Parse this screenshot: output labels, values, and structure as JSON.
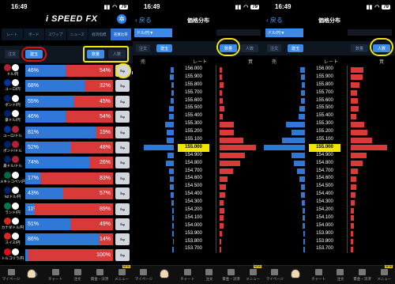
{
  "status": {
    "time": "16:49",
    "battery": "79"
  },
  "main": {
    "logo": "i SPEED FX",
    "tabs": [
      "レート",
      "ボード",
      "スワップ",
      "ニュース",
      "経済指標",
      "売買比率"
    ],
    "sub_tabs": [
      "注文",
      "建玉"
    ],
    "mode_buttons": [
      "数量",
      "人数"
    ],
    "pairs": [
      {
        "name": "ドル/円",
        "buy": "46%",
        "sell": "54%",
        "buy_frac": 0.46,
        "c1": "#b22234",
        "c2": "#ffffff"
      },
      {
        "name": "ユーロ/円",
        "buy": "68%",
        "sell": "32%",
        "buy_frac": 0.68,
        "c1": "#003399",
        "c2": "#ffffff"
      },
      {
        "name": "ポンド/円",
        "buy": "55%",
        "sell": "45%",
        "buy_frac": 0.55,
        "c1": "#012169",
        "c2": "#ffffff"
      },
      {
        "name": "豪ドル/円",
        "buy": "46%",
        "sell": "54%",
        "buy_frac": 0.46,
        "c1": "#012169",
        "c2": "#ffffff"
      },
      {
        "name": "ユーロ/ドル",
        "buy": "81%",
        "sell": "19%",
        "buy_frac": 0.81,
        "c1": "#003399",
        "c2": "#b22234"
      },
      {
        "name": "ポンド/ドル",
        "buy": "52%",
        "sell": "48%",
        "buy_frac": 0.52,
        "c1": "#012169",
        "c2": "#b22234"
      },
      {
        "name": "豪ドル/ドル",
        "buy": "74%",
        "sell": "26%",
        "buy_frac": 0.74,
        "c1": "#012169",
        "c2": "#b22234"
      },
      {
        "name": "メキシコペソ/円",
        "buy": "17%",
        "sell": "83%",
        "buy_frac": 0.17,
        "c1": "#006847",
        "c2": "#ffffff"
      },
      {
        "name": "NZドル/円",
        "buy": "43%",
        "sell": "57%",
        "buy_frac": 0.43,
        "c1": "#012169",
        "c2": "#ffffff"
      },
      {
        "name": "ランド/円",
        "buy": "11%",
        "sell": "89%",
        "buy_frac": 0.11,
        "c1": "#007a4d",
        "c2": "#ffffff"
      },
      {
        "name": "カナダドル/円",
        "buy": "51%",
        "sell": "49%",
        "buy_frac": 0.51,
        "c1": "#d52b1e",
        "c2": "#ffffff"
      },
      {
        "name": "スイス/円",
        "buy": "86%",
        "sell": "14%",
        "buy_frac": 0.86,
        "c1": "#d52b1e",
        "c2": "#ffffff"
      },
      {
        "name": "トルコリラ/円",
        "buy": "0%",
        "sell": "100%",
        "buy_frac": 0.0,
        "c1": "#e30a17",
        "c2": "#ffffff"
      }
    ]
  },
  "dist": {
    "back": "戻る",
    "title": "価格分布",
    "pair": "ドル/円▼",
    "mode_buttons": [
      "注文",
      "建玉",
      "数量",
      "人数"
    ],
    "col_sell": "売",
    "col_rate": "レート",
    "col_buy": "買",
    "current_price": "155.000",
    "prices": [
      "156.000",
      "155.900",
      "155.800",
      "155.700",
      "155.600",
      "155.500",
      "155.400",
      "155.300",
      "155.200",
      "155.100",
      "155.000",
      "154.900",
      "154.800",
      "154.700",
      "154.600",
      "154.500",
      "154.400",
      "154.300",
      "154.200",
      "154.100",
      "154.000",
      "153.900",
      "153.800",
      "153.700"
    ]
  },
  "dist_qty": {
    "sell": [
      4,
      5,
      3,
      3,
      4,
      6,
      6,
      11,
      9,
      9,
      38,
      8,
      10,
      6,
      5,
      5,
      4,
      3,
      2,
      2,
      2,
      2,
      1,
      2
    ],
    "buy": [
      3,
      3,
      5,
      3,
      4,
      6,
      4,
      17,
      17,
      29,
      44,
      31,
      25,
      16,
      10,
      8,
      7,
      5,
      6,
      5,
      5,
      3,
      2,
      2
    ]
  },
  "dist_ppl": {
    "sell": [
      6,
      5,
      4,
      5,
      5,
      7,
      8,
      24,
      17,
      29,
      52,
      17,
      14,
      10,
      7,
      5,
      5,
      4,
      3,
      3,
      3,
      2,
      2,
      2
    ],
    "buy": [
      15,
      14,
      11,
      8,
      9,
      10,
      7,
      16,
      20,
      26,
      44,
      19,
      14,
      9,
      7,
      7,
      6,
      5,
      4,
      4,
      4,
      3,
      3,
      3
    ]
  },
  "nav": [
    "マイページ",
    "",
    "チャート",
    "注文",
    "資金・決済",
    "メニュー"
  ],
  "nav_new": "NEW"
}
